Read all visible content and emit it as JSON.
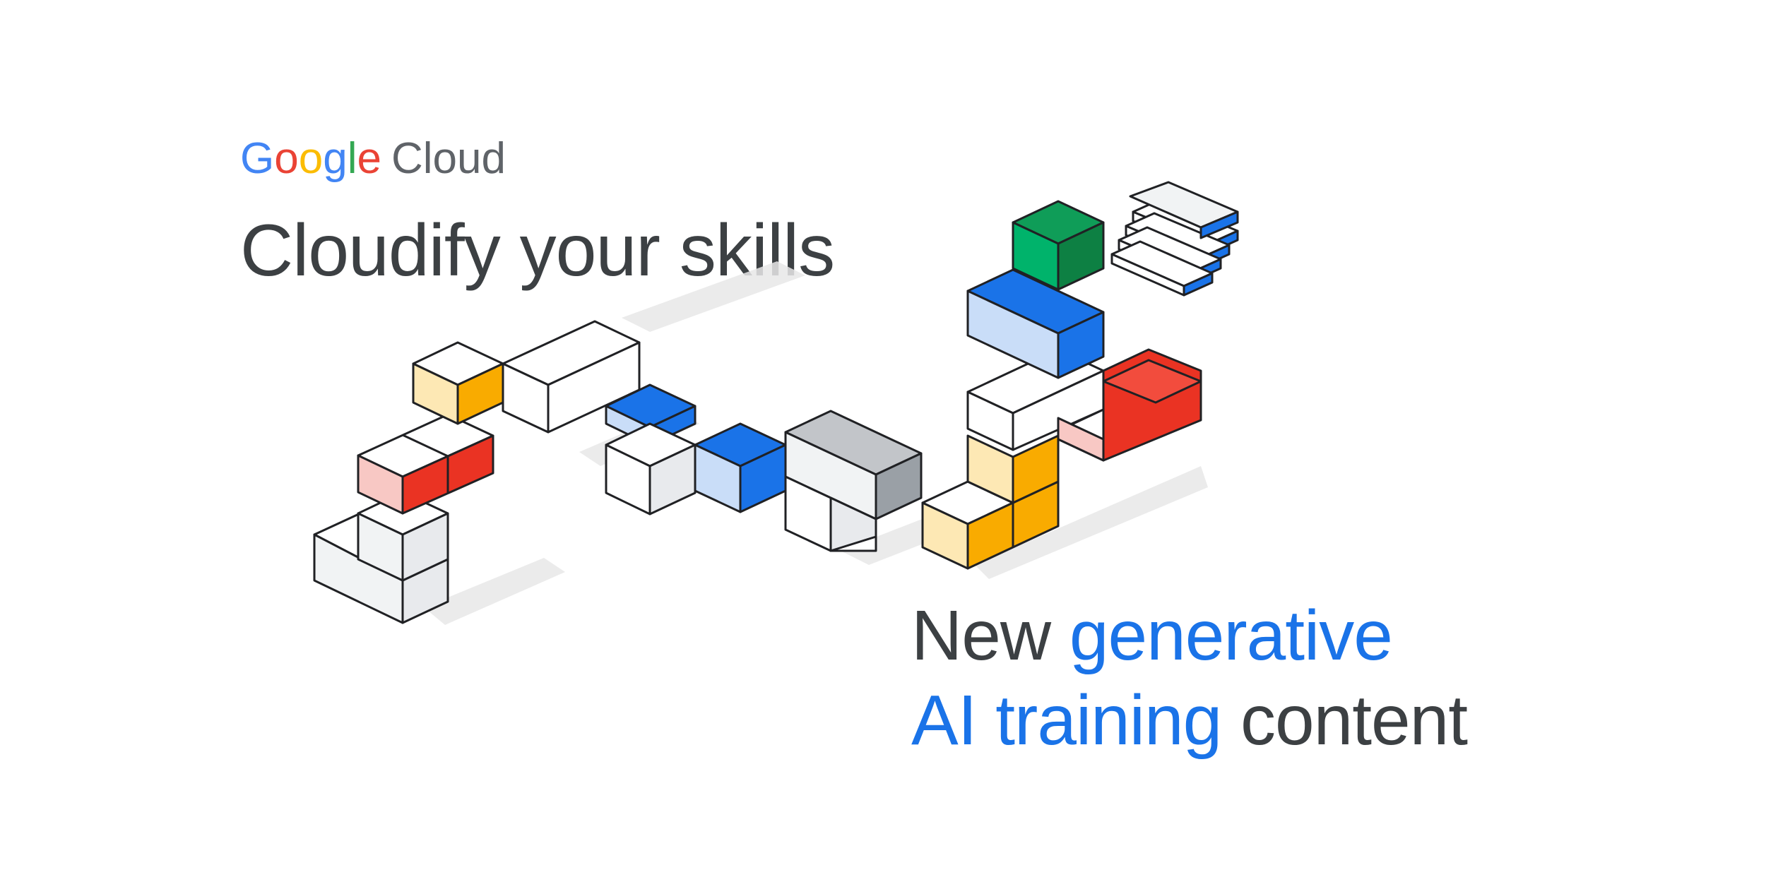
{
  "brand": {
    "letters": [
      {
        "char": "G",
        "color": "#4285F4"
      },
      {
        "char": "o",
        "color": "#EA4335"
      },
      {
        "char": "o",
        "color": "#FBBC04"
      },
      {
        "char": "g",
        "color": "#4285F4"
      },
      {
        "char": "l",
        "color": "#34A853"
      },
      {
        "char": "e",
        "color": "#EA4335"
      }
    ],
    "product": "Cloud"
  },
  "headline": "Cloudify your skills",
  "tagline": {
    "line1_plain": "New",
    "line1_accent": "generative",
    "line2_accent": "AI training",
    "line2_plain": "content"
  },
  "colors": {
    "text": "#3c4043",
    "accent": "#1a73e8",
    "blue": "#1a73e8",
    "green": "#0d8043",
    "red": "#ea3323",
    "yellow": "#f9ab00",
    "gray": "#9aa0a6"
  },
  "illustration": "isometric-cube-staircase"
}
